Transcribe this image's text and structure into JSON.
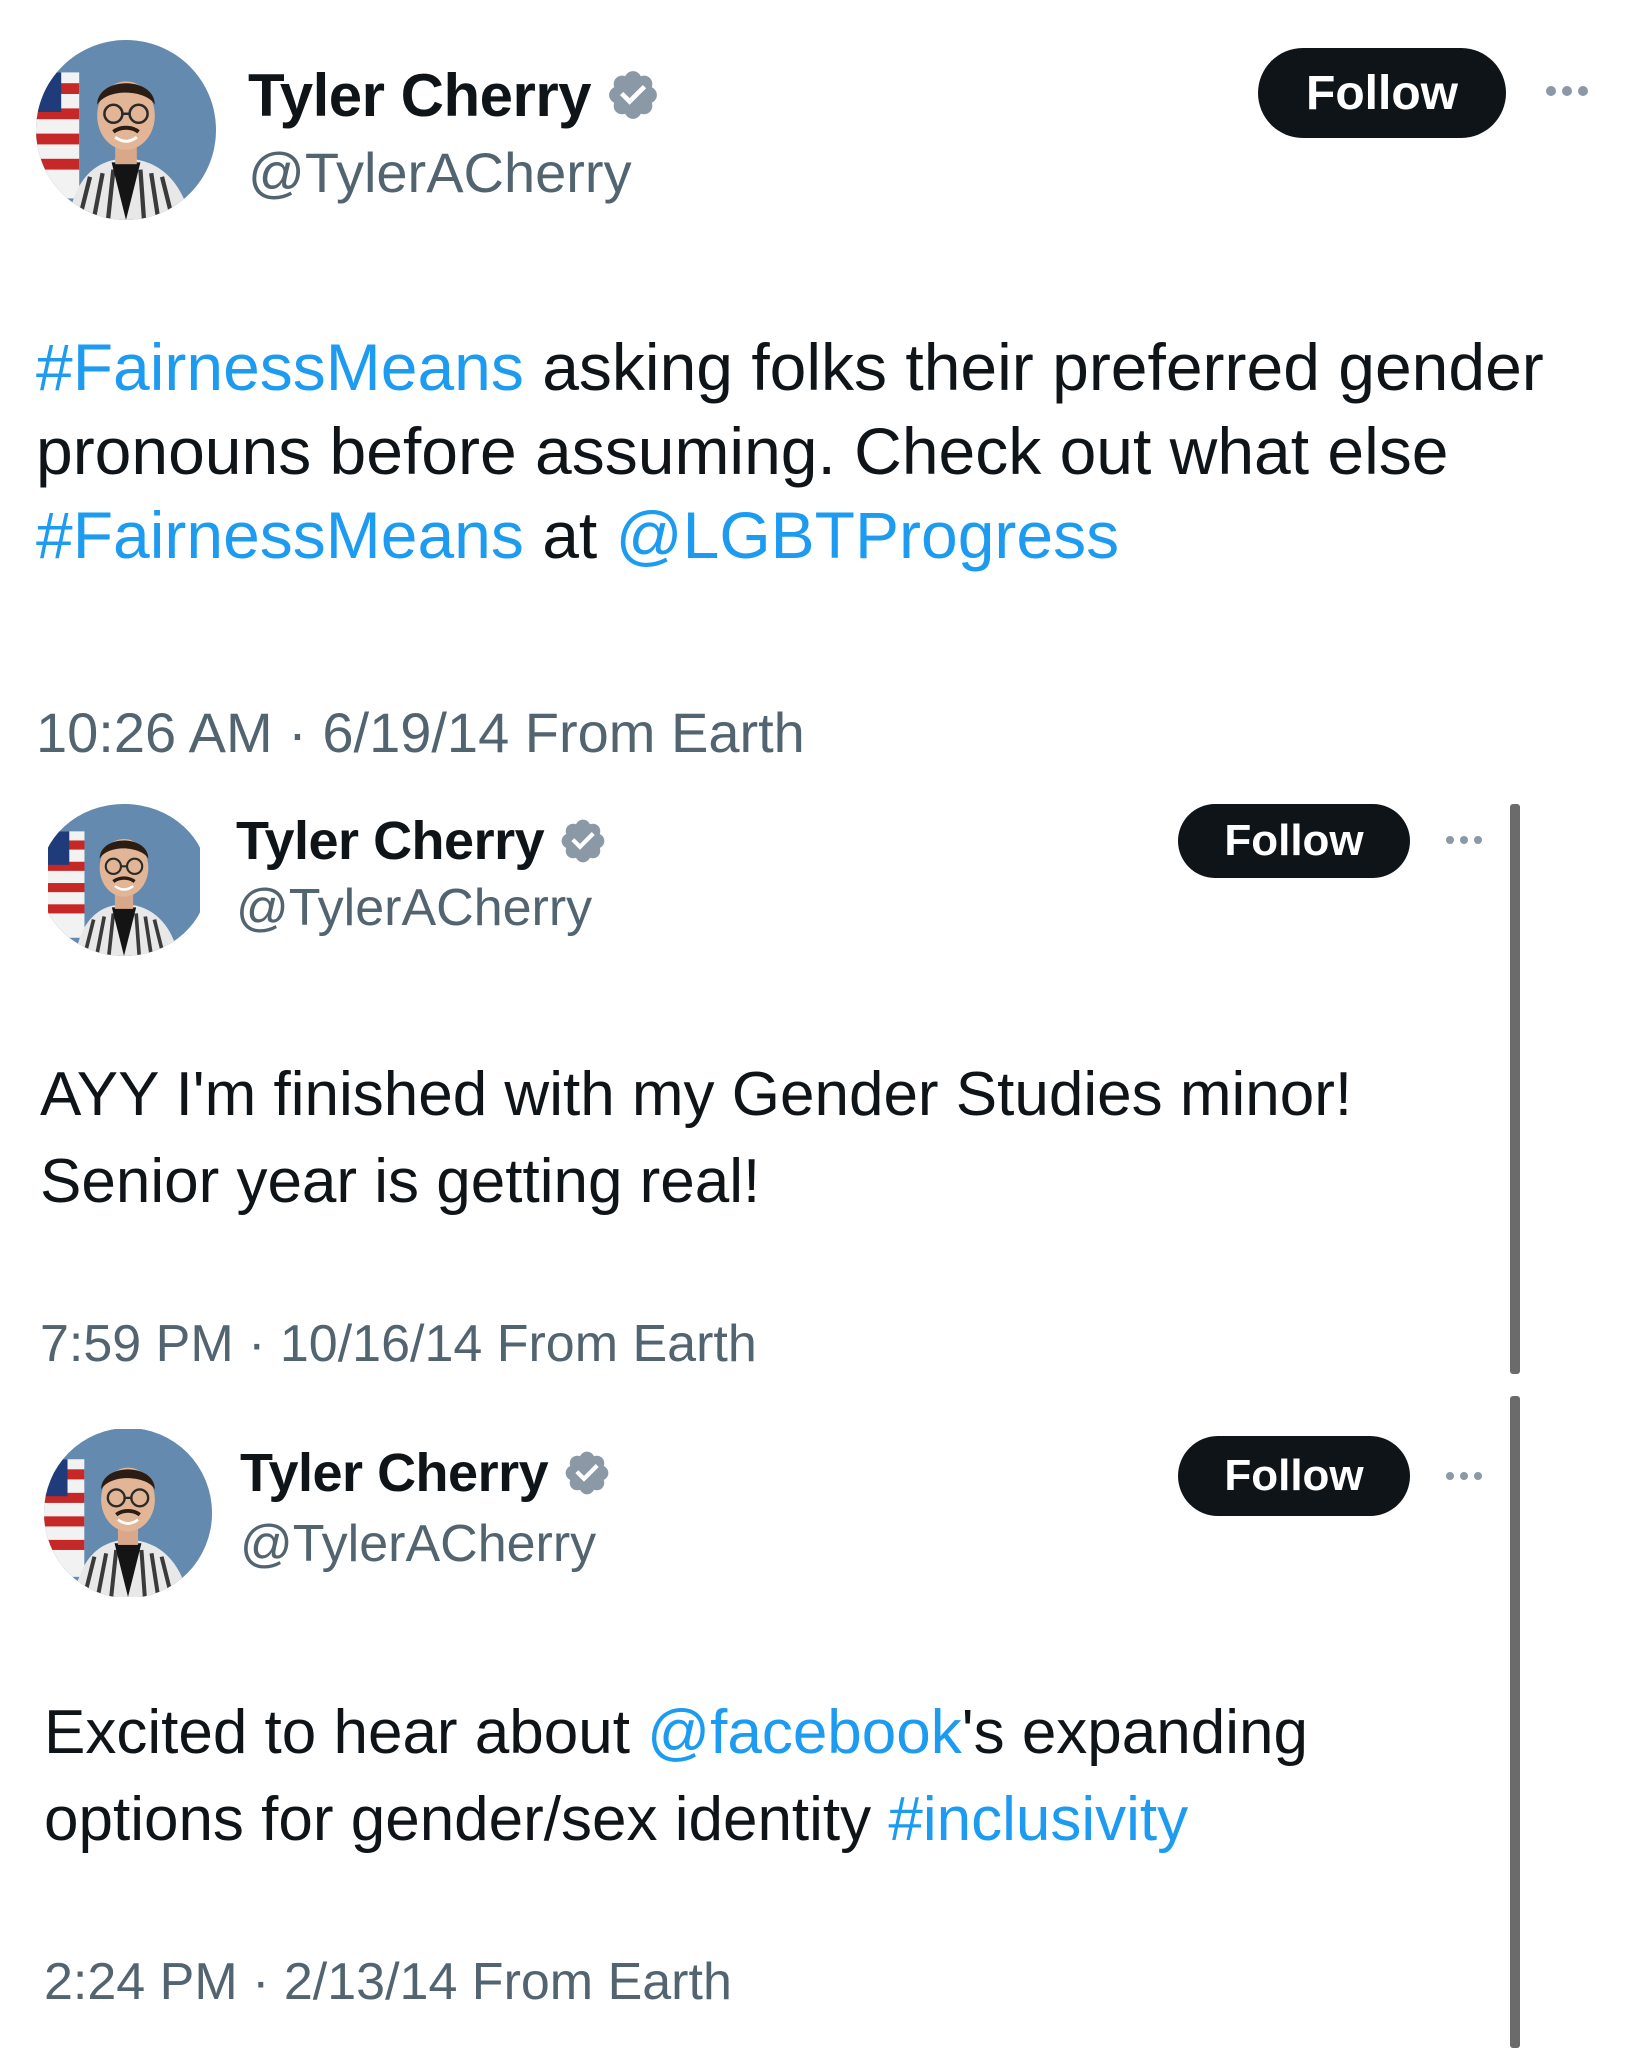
{
  "colors": {
    "link": "#1d9bf0",
    "secondary_text": "#536471",
    "primary_text": "#0f1419",
    "verified": "#8b98a5",
    "button_bg": "#0f1419"
  },
  "tweets": [
    {
      "author": {
        "name": "Tyler Cherry",
        "handle": "@TylerACherry",
        "verified_icon": "verified-badge-icon"
      },
      "follow_label": "Follow",
      "body": {
        "s0": "#FairnessMeans",
        "s1": " asking folks their preferred gender pronouns before assuming. Check out what else ",
        "s2": "#FairnessMeans",
        "s3": " at ",
        "s4": "@LGBTProgress"
      },
      "meta": "10:26 AM · 6/19/14 From Earth"
    },
    {
      "author": {
        "name": "Tyler Cherry",
        "handle": "@TylerACherry",
        "verified_icon": "verified-badge-icon"
      },
      "follow_label": "Follow",
      "body": {
        "s0": "AYY I'm finished with my Gender Studies minor! Senior year is getting real!"
      },
      "meta": "7:59 PM · 10/16/14 From Earth"
    },
    {
      "author": {
        "name": "Tyler Cherry",
        "handle": "@TylerACherry",
        "verified_icon": "verified-badge-icon"
      },
      "follow_label": "Follow",
      "body": {
        "s0": "Excited to hear about ",
        "s1": "@facebook",
        "s2": "'s expanding options for gender/sex identity ",
        "s3": "#inclusivity"
      },
      "meta": "2:24 PM · 2/13/14 From Earth"
    }
  ]
}
